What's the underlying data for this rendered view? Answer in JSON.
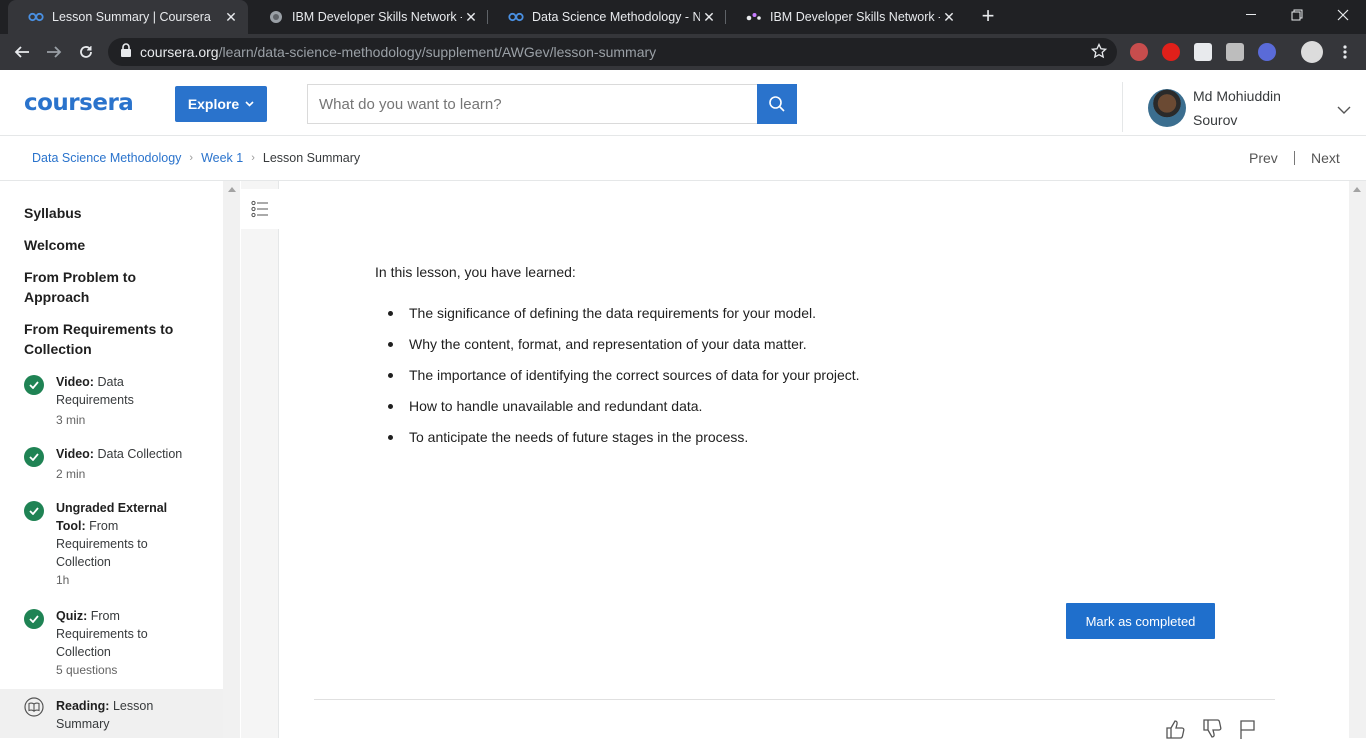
{
  "browser": {
    "tabs": [
      {
        "title": "Lesson Summary | Coursera",
        "icon": "coursera-icon",
        "active": true
      },
      {
        "title": "IBM Developer Skills Network - L",
        "icon": "globe-icon",
        "active": false
      },
      {
        "title": "Data Science Methodology - Not",
        "icon": "coursera-icon",
        "active": false
      },
      {
        "title": "IBM Developer Skills Network - L",
        "icon": "dots-icon",
        "active": false
      }
    ],
    "new_tab": "+",
    "url_domain": "coursera.org",
    "url_path": "/learn/data-science-methodology/supplement/AWGev/lesson-summary"
  },
  "header": {
    "logo": "coursera",
    "explore_label": "Explore",
    "search_placeholder": "What do you want to learn?",
    "user_name": "Md Mohiuddin Sourov"
  },
  "breadcrumb": {
    "items": [
      "Data Science Methodology",
      "Week 1"
    ],
    "current": "Lesson Summary",
    "prev": "Prev",
    "next": "Next"
  },
  "sidebar": {
    "sections": [
      "Syllabus",
      "Welcome",
      "From Problem to Approach",
      "From Requirements to Collection"
    ],
    "items": [
      {
        "type": "Video:",
        "title": "Data Requirements",
        "meta": "3 min",
        "status": "completed"
      },
      {
        "type": "Video:",
        "title": "Data Collection",
        "meta": "2 min",
        "status": "completed"
      },
      {
        "type": "Ungraded External Tool:",
        "title": "From Requirements to Collection",
        "meta": "1h",
        "status": "completed"
      },
      {
        "type": "Quiz:",
        "title": "From Requirements to Collection",
        "meta": "5 questions",
        "status": "completed"
      },
      {
        "type": "Reading:",
        "title": "Lesson Summary",
        "meta": "",
        "status": "current"
      }
    ]
  },
  "content": {
    "intro": "In this lesson, you have learned:",
    "bullets": [
      "The significance of defining the data requirements for your model.",
      "Why the content, format, and representation of your data matter.",
      "The importance of identifying the correct sources of data for your project.",
      "How to handle unavailable and redundant data.",
      "To anticipate the needs of future stages in the process."
    ],
    "mark_completed": "Mark as completed"
  },
  "colors": {
    "brand": "#2a73cc",
    "check": "#1f8354"
  }
}
